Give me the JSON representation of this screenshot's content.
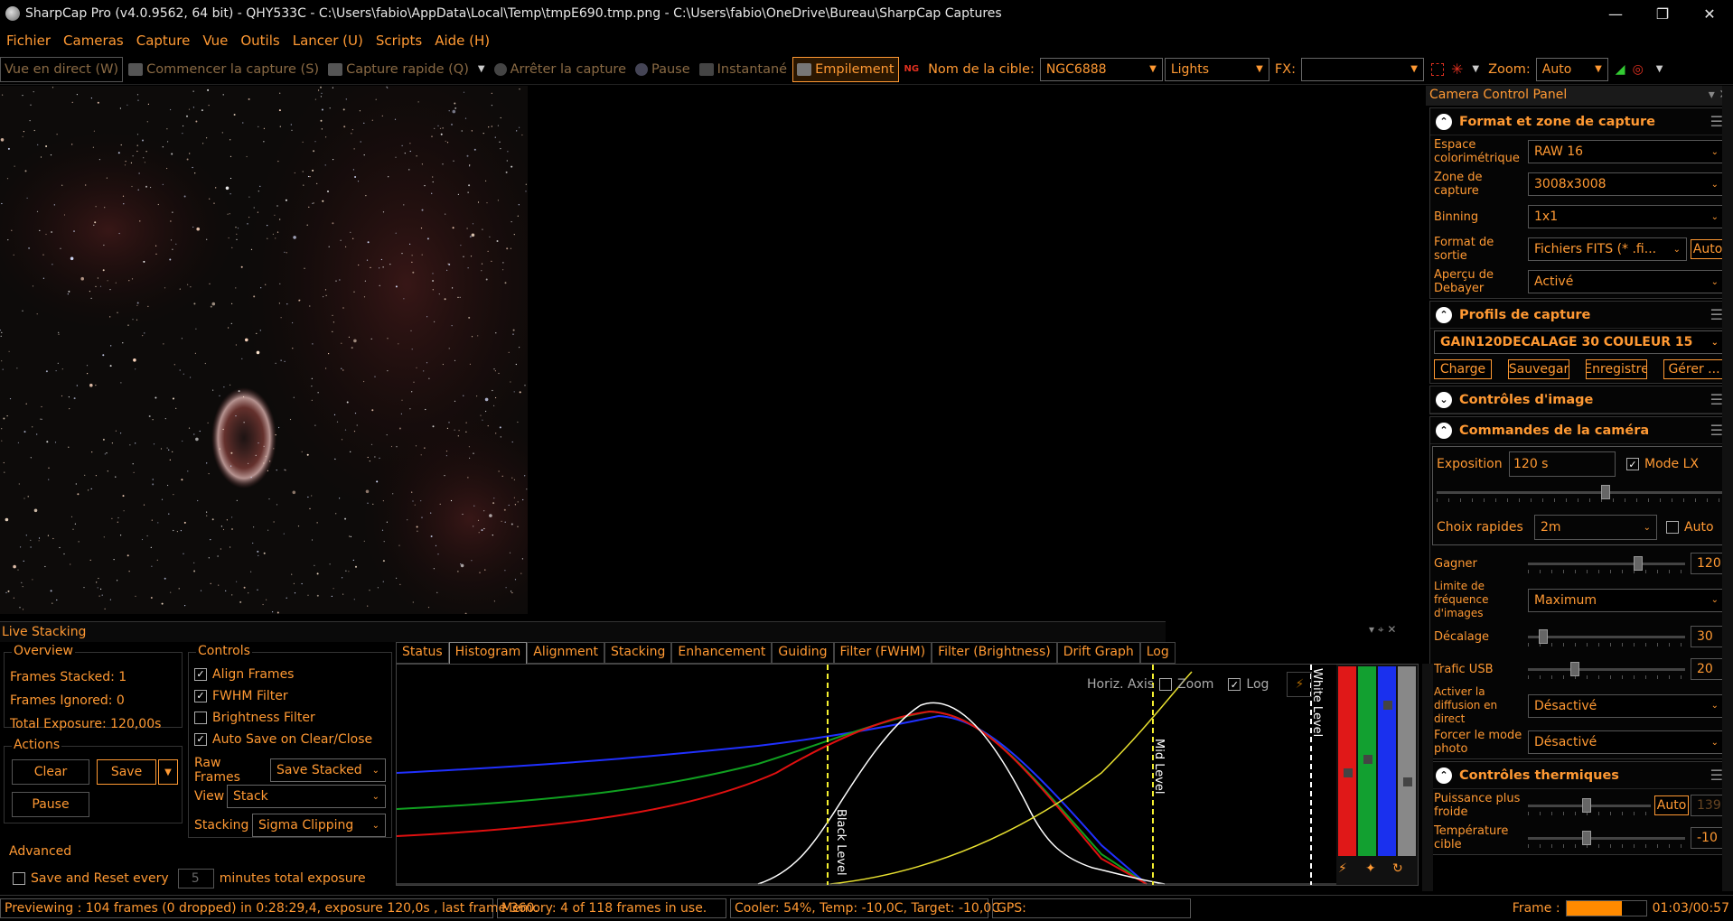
{
  "titlebar": {
    "title": "SharpCap Pro (v4.0.9562, 64 bit) - QHY533C - C:\\Users\\fabio\\AppData\\Local\\Temp\\tmpE690.tmp.png - C:\\Users\\fabio\\OneDrive\\Bureau\\SharpCap Captures"
  },
  "menu": [
    "Fichier",
    "Cameras",
    "Capture",
    "Vue",
    "Outils",
    "Lancer (U)",
    "Scripts",
    "Aide (H)"
  ],
  "toolbar": {
    "live_view": "Vue en direct (W)",
    "start_capture": "Commencer la capture (S)",
    "quick_capture": "Capture rapide (Q)",
    "stop_capture": "Arrêter la capture",
    "pause": "Pause",
    "snapshot": "Instantané",
    "stacking": "Empilement",
    "target_label": "Nom de la cible:",
    "target_value": "NGC6888",
    "frame_type": "Lights",
    "fx_label": "FX:",
    "zoom_label": "Zoom:",
    "zoom_value": "Auto"
  },
  "ccp": {
    "title": "Camera Control Panel",
    "format": {
      "title": "Format et zone de capture",
      "colorspace_label": "Espace colorimétrique",
      "colorspace_value": "RAW 16",
      "roi_label": "Zone de capture",
      "roi_value": "3008x3008",
      "binning_label": "Binning",
      "binning_value": "1x1",
      "output_label": "Format de sortie",
      "output_value": "Fichiers FITS (* .fi...",
      "output_auto": "Auto",
      "debayer_label": "Aperçu de Debayer",
      "debayer_value": "Activé"
    },
    "profiles": {
      "title": "Profils de capture",
      "value": "GAIN120DECALAGE 30 COULEUR 15",
      "load": "Charge",
      "save": "Sauvegar",
      "record": "Enregistre",
      "manage": "Gérer ..."
    },
    "image_controls": {
      "title": "Contrôles d'image"
    },
    "camera_controls": {
      "title": "Commandes de la caméra",
      "exposure_label": "Exposition",
      "exposure_value": "120 s",
      "lx_label": "Mode LX",
      "quick_label": "Choix rapides",
      "quick_value": "2m",
      "auto_label": "Auto",
      "gain_label": "Gagner",
      "gain_value": "120",
      "gain_level": 0.7,
      "fps_label": "Limite de fréquence d'images",
      "fps_value": "Maximum",
      "offset_label": "Décalage",
      "offset_value": "30",
      "offset_level": 0.1,
      "usb_label": "Trafic USB",
      "usb_value": "20",
      "usb_level": 0.3,
      "stream_label": "Activer la diffusion en direct",
      "stream_value": "Désactivé",
      "photo_label": "Forcer le mode photo",
      "photo_value": "Désactivé"
    },
    "thermal": {
      "title": "Contrôles thermiques",
      "power_label": "Puissance plus froide",
      "power_auto": "Auto",
      "power_value": "139",
      "target_label": "Température cible",
      "target_value": "-10"
    }
  },
  "live_stacking": {
    "title": "Live Stacking",
    "overview": {
      "title": "Overview",
      "stacked": "Frames Stacked:  1",
      "ignored": "Frames Ignored:  0",
      "exposure": "Total Exposure:    120,00s"
    },
    "actions": {
      "title": "Actions",
      "clear": "Clear",
      "save": "Save",
      "pause": "Pause"
    },
    "advanced": {
      "title": "Advanced",
      "save_reset": "Save and Reset every",
      "minutes": "5",
      "suffix": "minutes total exposure"
    },
    "controls": {
      "title": "Controls",
      "align": "Align Frames",
      "fwhm": "FWHM Filter",
      "brightness": "Brightness Filter",
      "autosave": "Auto Save on Clear/Close",
      "raw_label": "Raw Frames",
      "raw_value": "Save Stacked",
      "view_label": "View",
      "view_value": "Stack",
      "stacking_label": "Stacking",
      "stacking_value": "Sigma Clipping"
    },
    "tabs": [
      "Status",
      "Histogram",
      "Alignment",
      "Stacking",
      "Enhancement",
      "Guiding",
      "Filter (FWHM)",
      "Filter (Brightness)",
      "Drift Graph",
      "Log"
    ],
    "histogram": {
      "horiz_axis": "Horiz. Axis",
      "zoom": "Zoom",
      "log": "Log",
      "black_level": "Black Level",
      "mid_level": "Mid Level",
      "white_level": "White Level"
    }
  },
  "status": {
    "previewing": "Previewing : 104 frames (0 dropped) in 0:28:29,4, exposure 120,0s , last frame 360.",
    "memory": "Memory: 4 of 118 frames in use.",
    "cooler": "Cooler: 54%, Temp: -10,0C, Target: -10,0C",
    "gps": "GPS:",
    "frame_label": "Frame :",
    "frame_progress": 0.7,
    "time": "01:03/00:57"
  },
  "colors": {
    "accent": "#ff9933",
    "background": "#000000"
  }
}
